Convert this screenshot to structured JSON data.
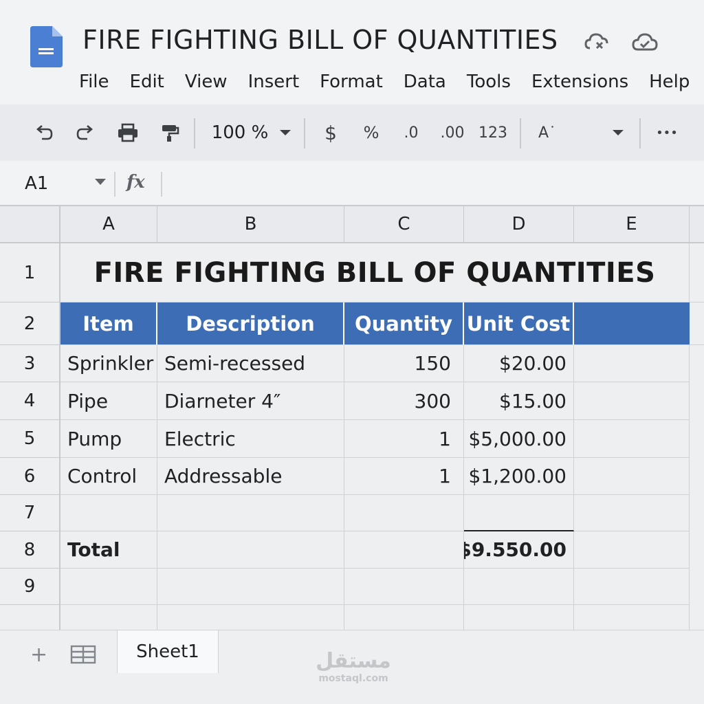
{
  "app": {
    "doc_title": "FIRE FIGHTING BILL OF QUANTITIES",
    "menu": [
      "File",
      "Edit",
      "View",
      "Insert",
      "Format",
      "Data",
      "Tools",
      "Extensions",
      "Help"
    ]
  },
  "toolbar": {
    "zoom": "100 %",
    "currency": "$",
    "percent": "%",
    "decrease_decimal": ".0",
    "increase_decimal": ".00",
    "number_format": "123",
    "font_size_label": "A˙",
    "more": "•••"
  },
  "formula_bar": {
    "cell_ref": "A1",
    "fx": "fx",
    "value": ""
  },
  "grid": {
    "columns": [
      "A",
      "B",
      "C",
      "D",
      "E"
    ],
    "rows": [
      "1",
      "2",
      "3",
      "4",
      "5",
      "6",
      "7",
      "8",
      "9"
    ],
    "title": "FIRE FIGHTING BILL OF QUANTITIES",
    "headers": [
      "Item",
      "Description",
      "Quantity",
      "Unit Cost",
      ""
    ],
    "data": [
      {
        "item": "Sprinkler",
        "description": "Semi-recessed",
        "quantity": "150",
        "unit_cost": "$20.00"
      },
      {
        "item": "Pipe",
        "description": "Diarneter 4″",
        "quantity": "300",
        "unit_cost": "$15.00"
      },
      {
        "item": "Pump",
        "description": "Electric",
        "quantity": "1",
        "unit_cost": "$5,000.00"
      },
      {
        "item": "Control",
        "description": "Addressable",
        "quantity": "1",
        "unit_cost": "$1,200.00"
      }
    ],
    "total_label": "Total",
    "total_value": "$9.550.00"
  },
  "sheets": {
    "add": "+",
    "tabs": [
      "Sheet1"
    ]
  },
  "watermark": {
    "logo": "مستقل",
    "url": "mostaql.com"
  },
  "colors": {
    "header_fill": "#3d6eb5",
    "doc_icon": "#4a7fd4",
    "chrome": "#f1f3f4"
  }
}
